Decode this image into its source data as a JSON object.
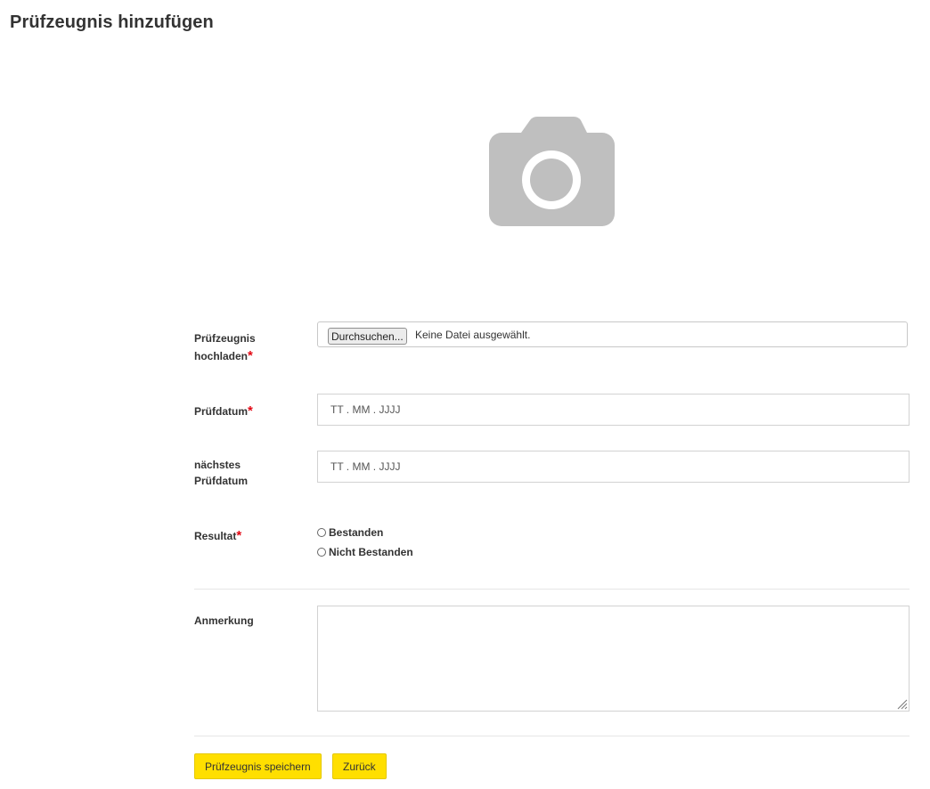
{
  "page": {
    "title": "Prüfzeugnis hinzufügen"
  },
  "image_placeholder": {
    "icon": "camera-icon",
    "color": "#bfbfbf"
  },
  "form": {
    "upload": {
      "label_line1": "Prüfzeugnis",
      "label_line2": "hochladen",
      "required_mark": "*",
      "browse_label": "Durchsuchen...",
      "status_text": "Keine Datei ausgewählt."
    },
    "test_date": {
      "label": "Prüfdatum",
      "required_mark": "*",
      "placeholder": "TT . MM . JJJJ",
      "value": ""
    },
    "next_test_date": {
      "label_line1": "nächstes",
      "label_line2": "Prüfdatum",
      "placeholder": "TT . MM . JJJJ",
      "value": ""
    },
    "result": {
      "label": "Resultat",
      "required_mark": "*",
      "options": [
        "Bestanden",
        "Nicht Bestanden"
      ],
      "selected": null
    },
    "remark": {
      "label": "Anmerkung",
      "value": ""
    }
  },
  "actions": {
    "save_label": "Prüfzeugnis speichern",
    "back_label": "Zurück"
  },
  "colors": {
    "accent": "#ffdf00",
    "required": "#e30613",
    "border": "#d2d2d2",
    "text": "#333333"
  }
}
